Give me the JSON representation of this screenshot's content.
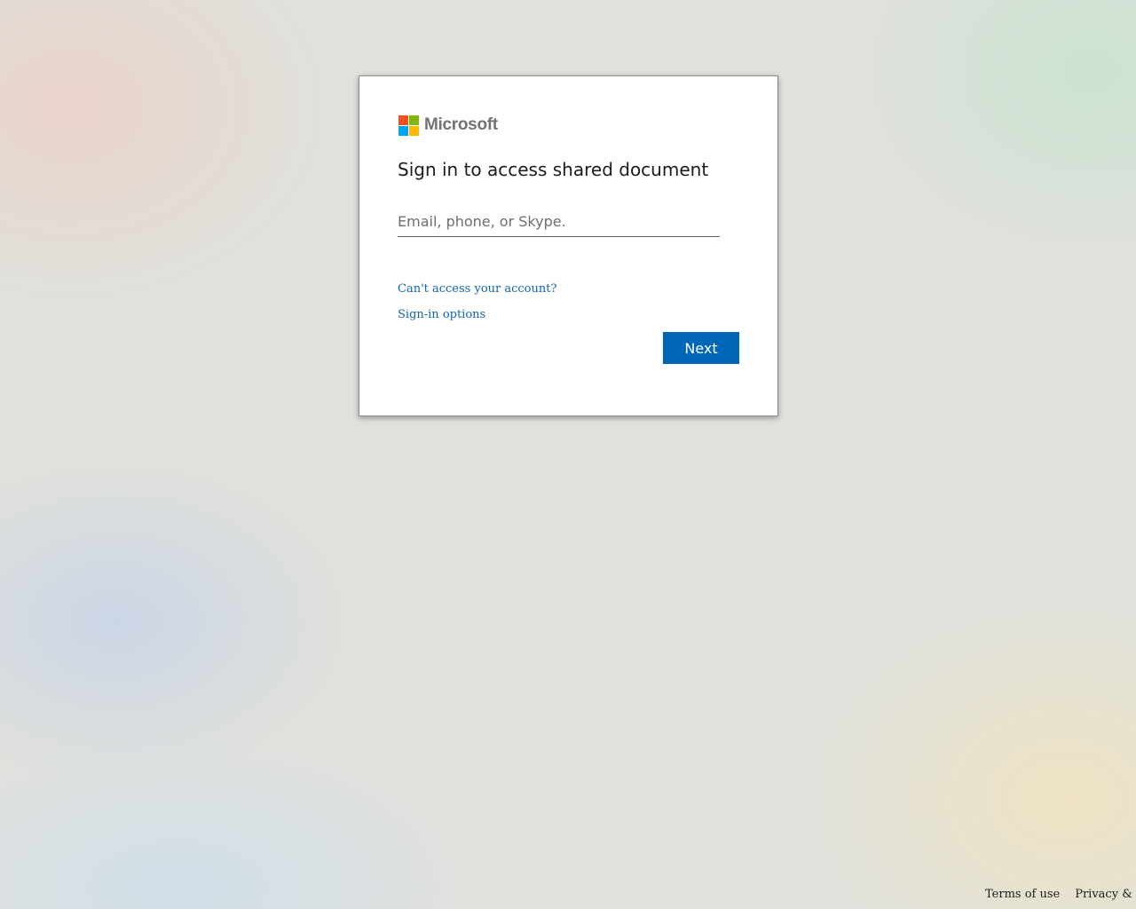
{
  "brand": {
    "name": "Microsoft",
    "logo_colors": [
      "#f25022",
      "#7fba00",
      "#00a4ef",
      "#ffb900"
    ]
  },
  "signin": {
    "title": "Sign in to access shared document",
    "email_placeholder": "Email, phone, or Skype.",
    "email_value": "",
    "cant_access_link": "Can't access your account?",
    "signin_options_link": "Sign-in options",
    "next_button": "Next"
  },
  "footer": {
    "terms": "Terms of use",
    "privacy": "Privacy & cookies"
  },
  "colors": {
    "accent": "#0067b8",
    "link": "#0f66b0"
  }
}
